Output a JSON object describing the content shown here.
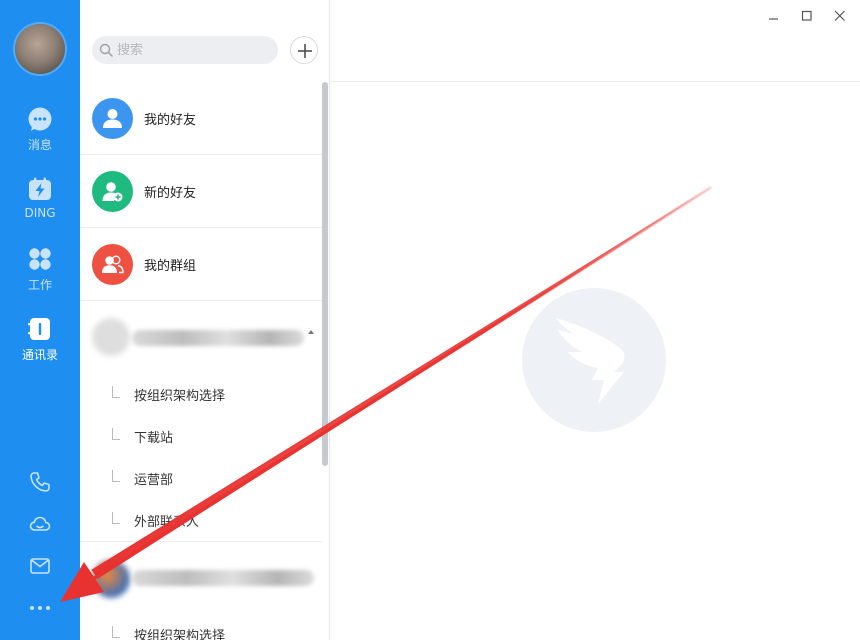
{
  "nav": {
    "items": [
      {
        "label": "消息",
        "icon": "chat-bubble-icon"
      },
      {
        "label": "DING",
        "icon": "ding-icon"
      },
      {
        "label": "工作",
        "icon": "apps-grid-icon"
      },
      {
        "label": "通讯录",
        "icon": "contacts-book-icon"
      }
    ],
    "active": "通讯录",
    "bottom_icons": [
      "phone-icon",
      "cloud-icon",
      "mail-icon",
      "more-dots-icon"
    ]
  },
  "search": {
    "placeholder": "搜索"
  },
  "contacts": {
    "rows": [
      {
        "label": "我的好友",
        "color": "#3c96f0",
        "icon": "person-icon"
      },
      {
        "label": "新的好友",
        "color": "#1fba7f",
        "icon": "person-add-icon"
      },
      {
        "label": "我的群组",
        "color": "#ee5042",
        "icon": "group-icon"
      }
    ],
    "org1_items": [
      "按组织架构选择",
      "下载站",
      "运营部",
      "外部联系人"
    ],
    "org2_items": [
      "按组织架构选择"
    ]
  },
  "colors": {
    "rail": "#1e8ef0",
    "annotation_arrow": "#e8322f"
  }
}
